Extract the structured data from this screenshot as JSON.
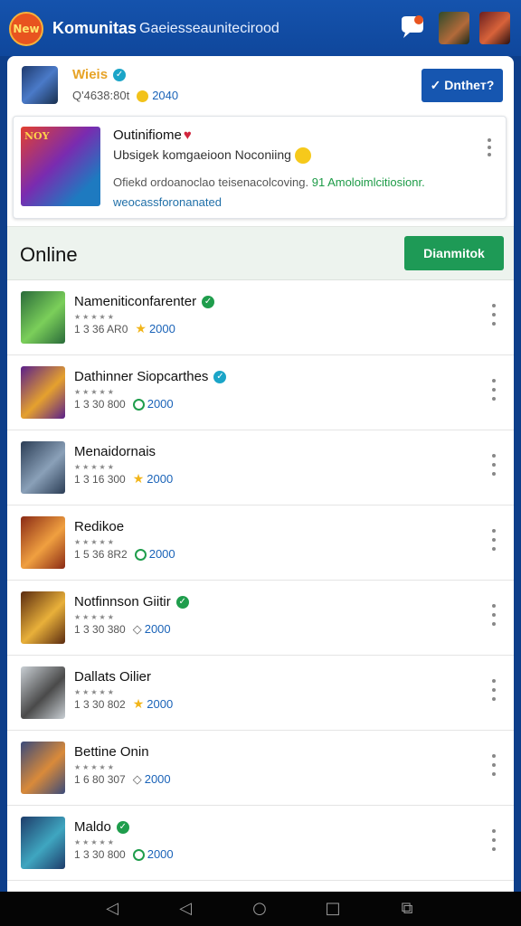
{
  "app": {
    "logo_text": "New",
    "title": "Komunitas",
    "subtitle": "Gaeiesseaunitecirood"
  },
  "profile": {
    "name": "Wieis",
    "meta": "Q'4638:80t",
    "points": "2040",
    "button_label": "✓ Dntheт?"
  },
  "feature": {
    "thumb_tag": "NOY",
    "title": "Outinifiome",
    "subtitle": "Ubsigek komgaeioon Noconiing",
    "desc_main": "Ofiekd ordoanoclao teisenacolcoving.",
    "desc_highlight": "91 Amoloimlcitiosionr.",
    "desc_link": "weocassforonanated"
  },
  "online": {
    "title": "Online",
    "button_label": "Dianmitok"
  },
  "users": [
    {
      "name": "Nameniticonfarenter",
      "verified": "green",
      "meta": "1 3 36 AR0",
      "badge": "star",
      "points": "2000",
      "c1": "#2a6b3a",
      "c2": "#7bcf5a"
    },
    {
      "name": "Dathinner Siopcarthes",
      "verified": "teal",
      "meta": "1 3 30 800",
      "badge": "ring",
      "points": "2000",
      "c1": "#5a1f8a",
      "c2": "#e5a12e"
    },
    {
      "name": "Menaidornais",
      "verified": "",
      "meta": "1 3 16 300",
      "badge": "star",
      "points": "2000",
      "c1": "#2b3d55",
      "c2": "#8aa0b8"
    },
    {
      "name": "Redikoe",
      "verified": "",
      "meta": "1 5 36 8R2",
      "badge": "ring",
      "points": "2000",
      "c1": "#8a2a15",
      "c2": "#f0a040"
    },
    {
      "name": "Notfinnson Giitir",
      "verified": "green",
      "meta": "1 3 30 380",
      "badge": "tag",
      "points": "2000",
      "c1": "#5a2b10",
      "c2": "#e8b03a"
    },
    {
      "name": "Dallats Oilier",
      "verified": "",
      "meta": "1 3 30 802",
      "badge": "star",
      "points": "2000",
      "c1": "#c9cfd4",
      "c2": "#4a4a4a"
    },
    {
      "name": "Bettine Onin",
      "verified": "",
      "meta": "1 6 80 307",
      "badge": "tag",
      "points": "2000",
      "c1": "#3a4a7a",
      "c2": "#d98a3a"
    },
    {
      "name": "Maldo",
      "verified": "green",
      "meta": "1 3 30 800",
      "badge": "ring",
      "points": "2000",
      "c1": "#1e3c6a",
      "c2": "#3fa6c0"
    }
  ],
  "colors": {
    "header_blue": "#1553ad",
    "primary_button": "#1656b0",
    "green_button": "#1e9a56",
    "points_blue": "#1a63b8"
  }
}
